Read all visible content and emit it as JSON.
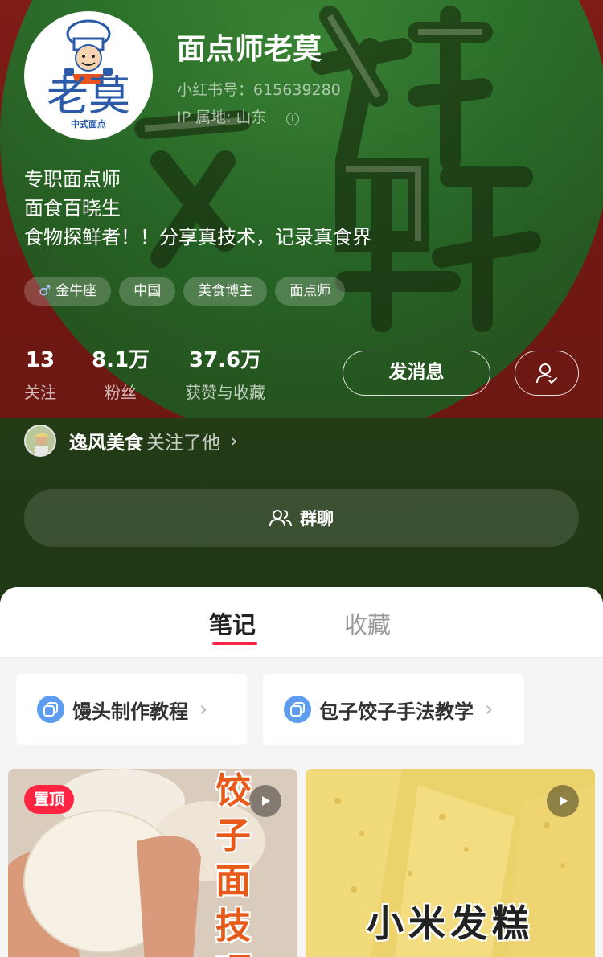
{
  "profile": {
    "name": "面点师老莫",
    "redbook_id": "小红书号：615639280",
    "ip_location": "IP 属地: 山东",
    "avatar_text": "老莫",
    "avatar_subtitle": "中式面点",
    "bio": [
      "专职面点师",
      "面食百晓生",
      "食物探鲜者！！分享真技术，记录真食界"
    ],
    "tags": [
      "金牛座",
      "中国",
      "美食博主",
      "面点师"
    ]
  },
  "stats": [
    {
      "value": "13",
      "label": "关注"
    },
    {
      "value": "8.1万",
      "label": "粉丝"
    },
    {
      "value": "37.6万",
      "label": "获赞与收藏"
    }
  ],
  "actions": {
    "message_label": "发消息",
    "group_chat_label": "群聊"
  },
  "followed_by": {
    "name": "逸风美食",
    "text": "关注了他"
  },
  "tabs": [
    "笔记",
    "收藏"
  ],
  "collections": [
    "馒头制作教程",
    "包子饺子手法教学"
  ],
  "notes": [
    {
      "badge": "置顶",
      "overlay_text": "饺子面技巧"
    },
    {
      "overlay_text": "小米发糕"
    }
  ],
  "colors": {
    "accent": "#ff2442",
    "collection_icon": "#5e9cf0"
  }
}
